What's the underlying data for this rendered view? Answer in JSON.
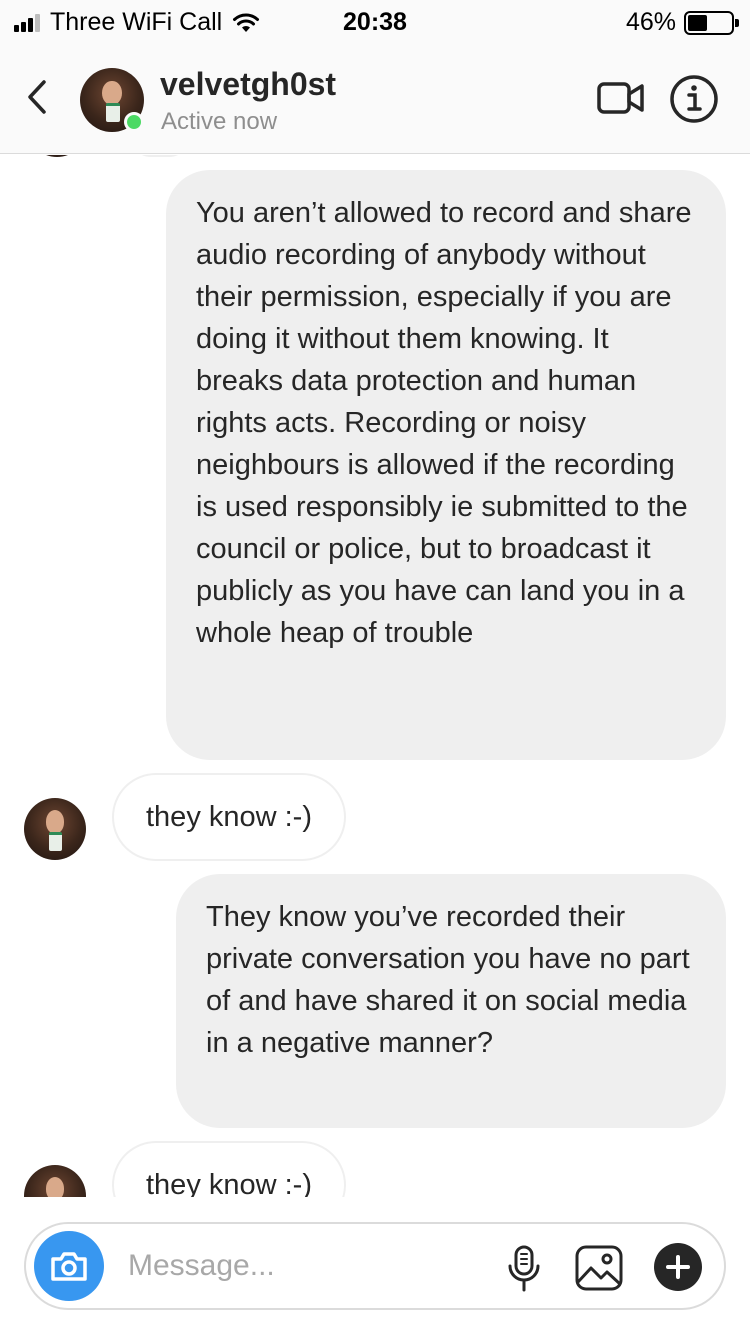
{
  "status_bar": {
    "carrier": "Three WiFi Call",
    "time": "20:38",
    "battery_percent": "46%",
    "battery_level": 0.46,
    "signal_bars_active": 3,
    "signal_bars_total": 4
  },
  "header": {
    "username": "velvetgh0st",
    "status": "Active now",
    "online_color": "#4cd964",
    "icons": [
      "back-chevron-icon",
      "video-call-icon",
      "info-icon"
    ]
  },
  "messages": [
    {
      "direction": "outgoing",
      "text": "You aren’t allowed to record and share audio recording of anybody without their permission, especially if you are doing it without them knowing. It breaks data protection and human rights acts. Recording or noisy neighbours is allowed if the recording is used responsibly ie submitted to the council or police, but to broadcast it publicly as you have can land you in a whole heap of trouble"
    },
    {
      "direction": "incoming",
      "text": "they know :-)"
    },
    {
      "direction": "outgoing",
      "text": "They know you’ve recorded their private conversation you have no part of and have shared it on social media in a negative manner?"
    },
    {
      "direction": "incoming",
      "text": "they know :-)"
    }
  ],
  "composer": {
    "placeholder": "Message...",
    "value": "",
    "accent_color": "#3897f0",
    "icons": [
      "camera-icon",
      "microphone-icon",
      "gallery-icon",
      "plus-icon"
    ]
  }
}
